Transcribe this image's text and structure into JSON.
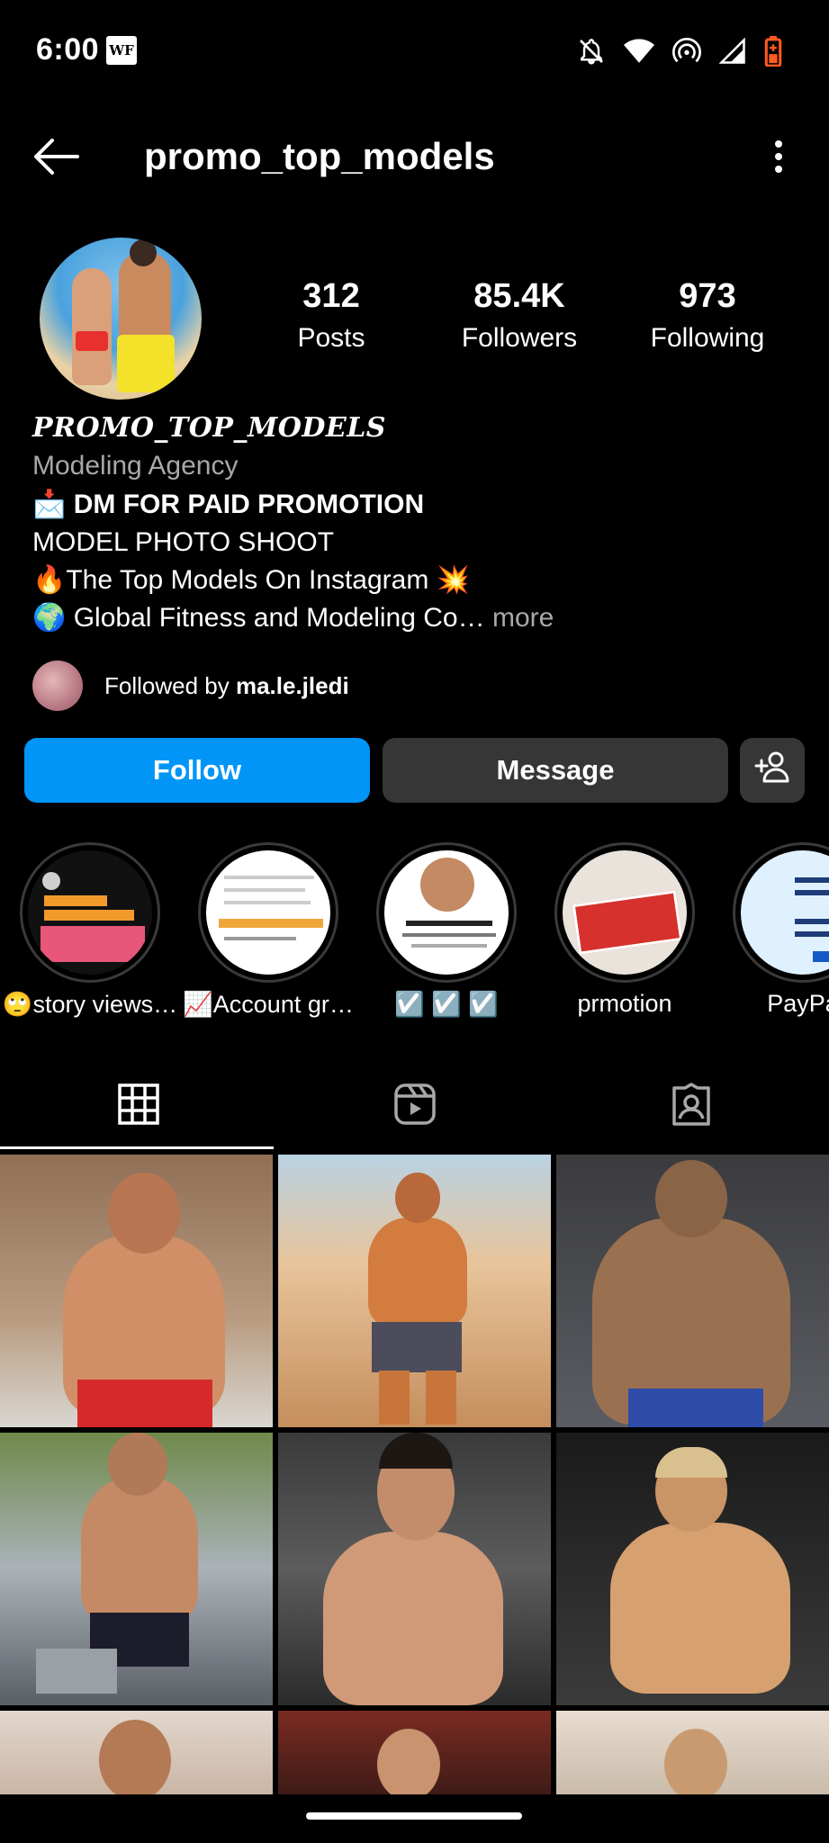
{
  "status_bar": {
    "time": "6:00",
    "badge": "WF",
    "icons": [
      "notifications-off-icon",
      "wifi-icon",
      "hotspot-icon",
      "cell-signal-icon",
      "battery-icon"
    ],
    "battery_color": "#ff5a1f"
  },
  "header": {
    "username": "promo_top_models",
    "back_icon": "arrow-left-icon",
    "menu_icon": "more-vertical-icon"
  },
  "profile": {
    "stats": [
      {
        "value": "312",
        "label": "Posts"
      },
      {
        "value": "85.4K",
        "label": "Followers"
      },
      {
        "value": "973",
        "label": "Following"
      }
    ],
    "display_name": "PROMO_TOP_MODELS",
    "category": "Modeling Agency",
    "bio": {
      "line1_emoji": "📩",
      "line1_text": "DM FOR PAID PROMOTION",
      "line2_text": "MODEL PHOTO SHOOT",
      "line3_prefix": "🔥",
      "line3_text": "The Top Models On Instagram",
      "line3_suffix": "💥",
      "line4_emoji": "🌍",
      "line4_text": "Global Fitness and Modeling Co…",
      "more_label": "more"
    },
    "followed_by_prefix": "Followed by",
    "followed_by_user": "ma.le.jledi"
  },
  "actions": {
    "follow_label": "Follow",
    "message_label": "Message",
    "suggest_icon": "add-person-icon"
  },
  "highlights": [
    {
      "label": "🙄story views…"
    },
    {
      "label": "📈Account gr…"
    },
    {
      "label": "☑️ ☑️ ☑️"
    },
    {
      "label": "prmotion"
    },
    {
      "label": "PayPa"
    }
  ],
  "tabs": [
    {
      "icon": "grid-icon",
      "active": true
    },
    {
      "icon": "reels-icon",
      "active": false
    },
    {
      "icon": "tagged-icon",
      "active": false
    }
  ],
  "colors": {
    "accent": "#0095f6",
    "button_secondary": "#363636",
    "muted_text": "#a8a8a8"
  }
}
